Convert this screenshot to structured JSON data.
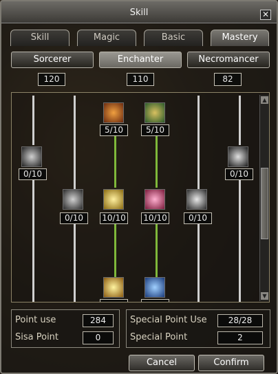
{
  "window": {
    "title": "Skill",
    "close_glyph": "✕"
  },
  "tabs": [
    {
      "label": "Skill"
    },
    {
      "label": "Magic"
    },
    {
      "label": "Basic"
    },
    {
      "label": "Mastery",
      "active": true
    }
  ],
  "classes": [
    {
      "label": "Sorcerer",
      "points": "120"
    },
    {
      "label": "Enchanter",
      "points": "110",
      "active": true
    },
    {
      "label": "Necromancer",
      "points": "82"
    }
  ],
  "skills": [
    {
      "count": "5/10",
      "icon": "fire-burst-icon",
      "color": "#c96a2a"
    },
    {
      "count": "5/10",
      "icon": "emblem-crest-icon",
      "color": "#6a8a3a"
    },
    {
      "count": "0/10",
      "icon": "dark-orb-icon",
      "color": "#777777"
    },
    {
      "count": "0/10",
      "icon": "ghost-wisp-icon",
      "color": "#8a8a8a"
    },
    {
      "count": "0/10",
      "icon": "shadow-wave-icon",
      "color": "#777777"
    },
    {
      "count": "10/10",
      "icon": "golden-beam-icon",
      "color": "#d6b23a"
    },
    {
      "count": "10/10",
      "icon": "pink-aura-icon",
      "color": "#d04a7a"
    },
    {
      "count": "0/10",
      "icon": "grey-streak-icon",
      "color": "#8a8a8a"
    },
    {
      "count": "",
      "icon": "golden-slash-icon",
      "color": "#d6a83a"
    },
    {
      "count": "",
      "icon": "blue-hand-icon",
      "color": "#3a7ac0"
    }
  ],
  "stats": {
    "point_use_label": "Point use",
    "point_use_value": "284",
    "sisa_point_label": "Sisa Point",
    "sisa_point_value": "0",
    "special_point_use_label": "Special Point Use",
    "special_point_use_value": "28/28",
    "special_point_label": "Special Point",
    "special_point_value": "2"
  },
  "actions": {
    "cancel": "Cancel",
    "confirm": "Confirm"
  },
  "scrollbar": {
    "up": "▲",
    "down": "▼"
  }
}
